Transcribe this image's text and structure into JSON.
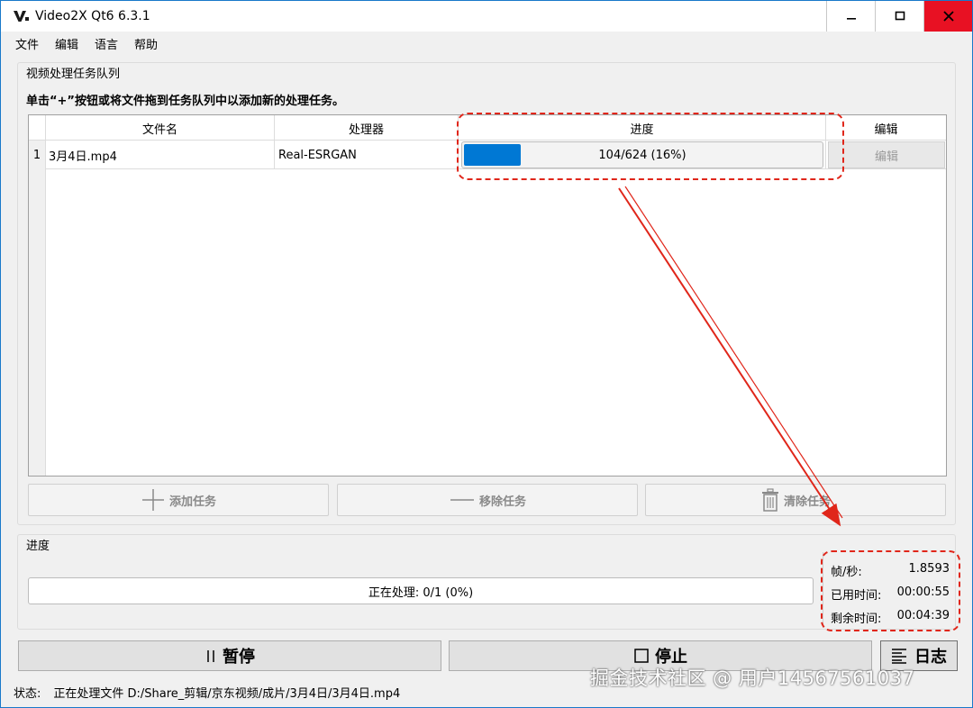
{
  "window": {
    "title": "Video2X Qt6 6.3.1",
    "icon": "video2x-logo-icon",
    "controls": [
      "minimize-icon",
      "maximize-icon",
      "close-icon"
    ]
  },
  "menu": [
    "文件",
    "编辑",
    "语言",
    "帮助"
  ],
  "queue": {
    "group_title": "视频处理任务队列",
    "hint": "单击“+”按钮或将文件拖到任务队列中以添加新的处理任务。",
    "columns": [
      "文件名",
      "处理器",
      "进度",
      "编辑"
    ],
    "rows": [
      {
        "index": "1",
        "filename": "3月4日.mp4",
        "processor": "Real-ESRGAN",
        "progress_text": "104/624 (16%)",
        "progress_value": 0.16,
        "edit_label": "编辑"
      }
    ],
    "buttons": {
      "add": "添加任务",
      "remove": "移除任务",
      "clear": "清除任务"
    }
  },
  "progress": {
    "group_title": "进度",
    "main_text": "正在处理: 0/1 (0%)",
    "stats": [
      {
        "label": "帧/秒:",
        "value": "1.8593"
      },
      {
        "label": "已用时间:",
        "value": "00:00:55"
      },
      {
        "label": "剩余时间:",
        "value": "00:04:39"
      }
    ]
  },
  "controls": {
    "pause": "暂停",
    "stop": "停止",
    "log": "日志"
  },
  "status": {
    "label": "状态:",
    "text": "正在处理文件 D:/Share_剪辑/京东视频/成片/3月4日/3月4日.mp4"
  },
  "watermark": "掘金技术社区 @ 用户14567561037",
  "colors": {
    "accent": "#0078d4",
    "annotation": "#e0261a",
    "close_button": "#e81123"
  }
}
